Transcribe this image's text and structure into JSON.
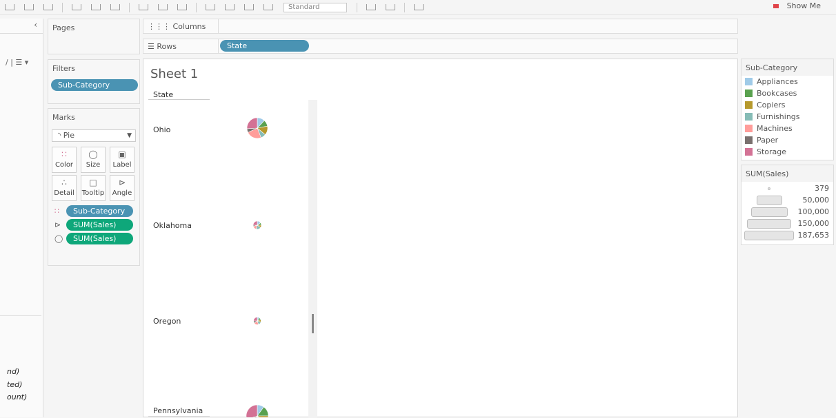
{
  "toolbar": {
    "standard_label": "Standard",
    "show_me_label": "Show Me"
  },
  "shelves": {
    "pages_label": "Pages",
    "columns_label": "Columns",
    "rows_label": "Rows",
    "rows_pill": "State",
    "filters_label": "Filters",
    "filter_pill": "Sub-Category"
  },
  "marks": {
    "title": "Marks",
    "type": "Pie",
    "buttons": [
      {
        "label": "Color"
      },
      {
        "label": "Size"
      },
      {
        "label": "Label"
      },
      {
        "label": "Detail"
      },
      {
        "label": "Tooltip"
      },
      {
        "label": "Angle"
      }
    ],
    "fields": [
      "Sub-Category",
      "SUM(Sales)",
      "SUM(Sales)"
    ]
  },
  "left_strip": {
    "italic_items": [
      "nd)",
      "ted)",
      "ount)"
    ]
  },
  "sheet": {
    "title": "Sheet 1",
    "column_header": "State",
    "states": [
      "Ohio",
      "Oklahoma",
      "Oregon",
      "Pennsylvania"
    ]
  },
  "chart_data": {
    "type": "pie",
    "rows": [
      {
        "state": "Ohio",
        "size_rank": "large",
        "slices": [
          {
            "category": "Appliances",
            "share": 0.12
          },
          {
            "category": "Bookcases",
            "share": 0.1
          },
          {
            "category": "Copiers",
            "share": 0.14
          },
          {
            "category": "Furnishings",
            "share": 0.08
          },
          {
            "category": "Machines",
            "share": 0.24
          },
          {
            "category": "Paper",
            "share": 0.06
          },
          {
            "category": "Storage",
            "share": 0.26
          }
        ]
      },
      {
        "state": "Oklahoma",
        "size_rank": "small",
        "slices": [
          {
            "category": "Appliances",
            "share": 0.15
          },
          {
            "category": "Bookcases",
            "share": 0.1
          },
          {
            "category": "Copiers",
            "share": 0.1
          },
          {
            "category": "Furnishings",
            "share": 0.2
          },
          {
            "category": "Machines",
            "share": 0.15
          },
          {
            "category": "Paper",
            "share": 0.05
          },
          {
            "category": "Storage",
            "share": 0.25
          }
        ]
      },
      {
        "state": "Oregon",
        "size_rank": "small",
        "slices": [
          {
            "category": "Appliances",
            "share": 0.1
          },
          {
            "category": "Bookcases",
            "share": 0.1
          },
          {
            "category": "Copiers",
            "share": 0.1
          },
          {
            "category": "Furnishings",
            "share": 0.15
          },
          {
            "category": "Machines",
            "share": 0.2
          },
          {
            "category": "Paper",
            "share": 0.1
          },
          {
            "category": "Storage",
            "share": 0.25
          }
        ]
      },
      {
        "state": "Pennsylvania",
        "size_rank": "large",
        "slices": [
          {
            "category": "Appliances",
            "share": 0.1
          },
          {
            "category": "Bookcases",
            "share": 0.15
          },
          {
            "category": "Copiers",
            "share": 0.1
          },
          {
            "category": "Furnishings",
            "share": 0.1
          },
          {
            "category": "Machines",
            "share": 0.15
          },
          {
            "category": "Paper",
            "share": 0.1
          },
          {
            "category": "Storage",
            "share": 0.3
          }
        ]
      }
    ],
    "size_scale": [
      379,
      187653
    ]
  },
  "color_legend": {
    "title": "Sub-Category",
    "items": [
      {
        "label": "Appliances",
        "color": "#a0cbe8"
      },
      {
        "label": "Bookcases",
        "color": "#59a14f"
      },
      {
        "label": "Copiers",
        "color": "#b6992d"
      },
      {
        "label": "Furnishings",
        "color": "#86bcb6"
      },
      {
        "label": "Machines",
        "color": "#ff9d9a"
      },
      {
        "label": "Paper",
        "color": "#79706e"
      },
      {
        "label": "Storage",
        "color": "#d37295"
      }
    ]
  },
  "size_legend": {
    "title": "SUM(Sales)",
    "items": [
      {
        "label": "379",
        "value": 379
      },
      {
        "label": "50,000",
        "value": 50000
      },
      {
        "label": "100,000",
        "value": 100000
      },
      {
        "label": "150,000",
        "value": 150000
      },
      {
        "label": "187,653",
        "value": 187653
      }
    ]
  }
}
